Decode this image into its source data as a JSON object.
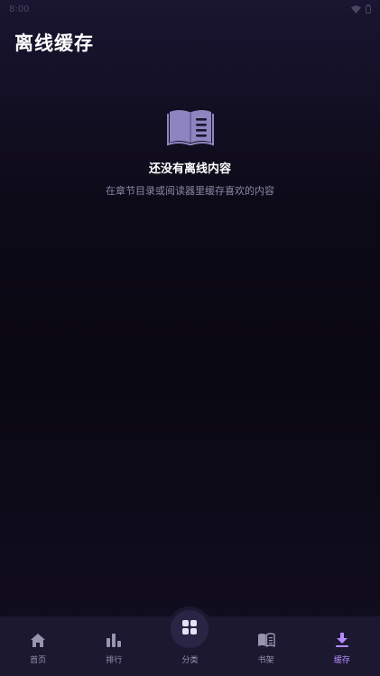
{
  "status_bar": {
    "time": "8:00"
  },
  "page": {
    "title": "离线缓存"
  },
  "empty_state": {
    "icon": "open-book-icon",
    "title": "还没有离线内容",
    "subtitle": "在章节目录或阅读器里缓存喜欢的内容"
  },
  "bottom_nav": {
    "items": [
      {
        "label": "首页",
        "icon": "home-icon"
      },
      {
        "label": "排行",
        "icon": "ranking-icon"
      },
      {
        "label": "分类",
        "icon": "category-grid-icon"
      },
      {
        "label": "书架",
        "icon": "bookshelf-icon"
      },
      {
        "label": "缓存",
        "icon": "download-icon",
        "active": true
      }
    ]
  },
  "colors": {
    "accent": "#b48cff",
    "nav_background": "#1c1830",
    "icon_muted": "#9a94b0",
    "book_icon": "#8e85c0"
  }
}
